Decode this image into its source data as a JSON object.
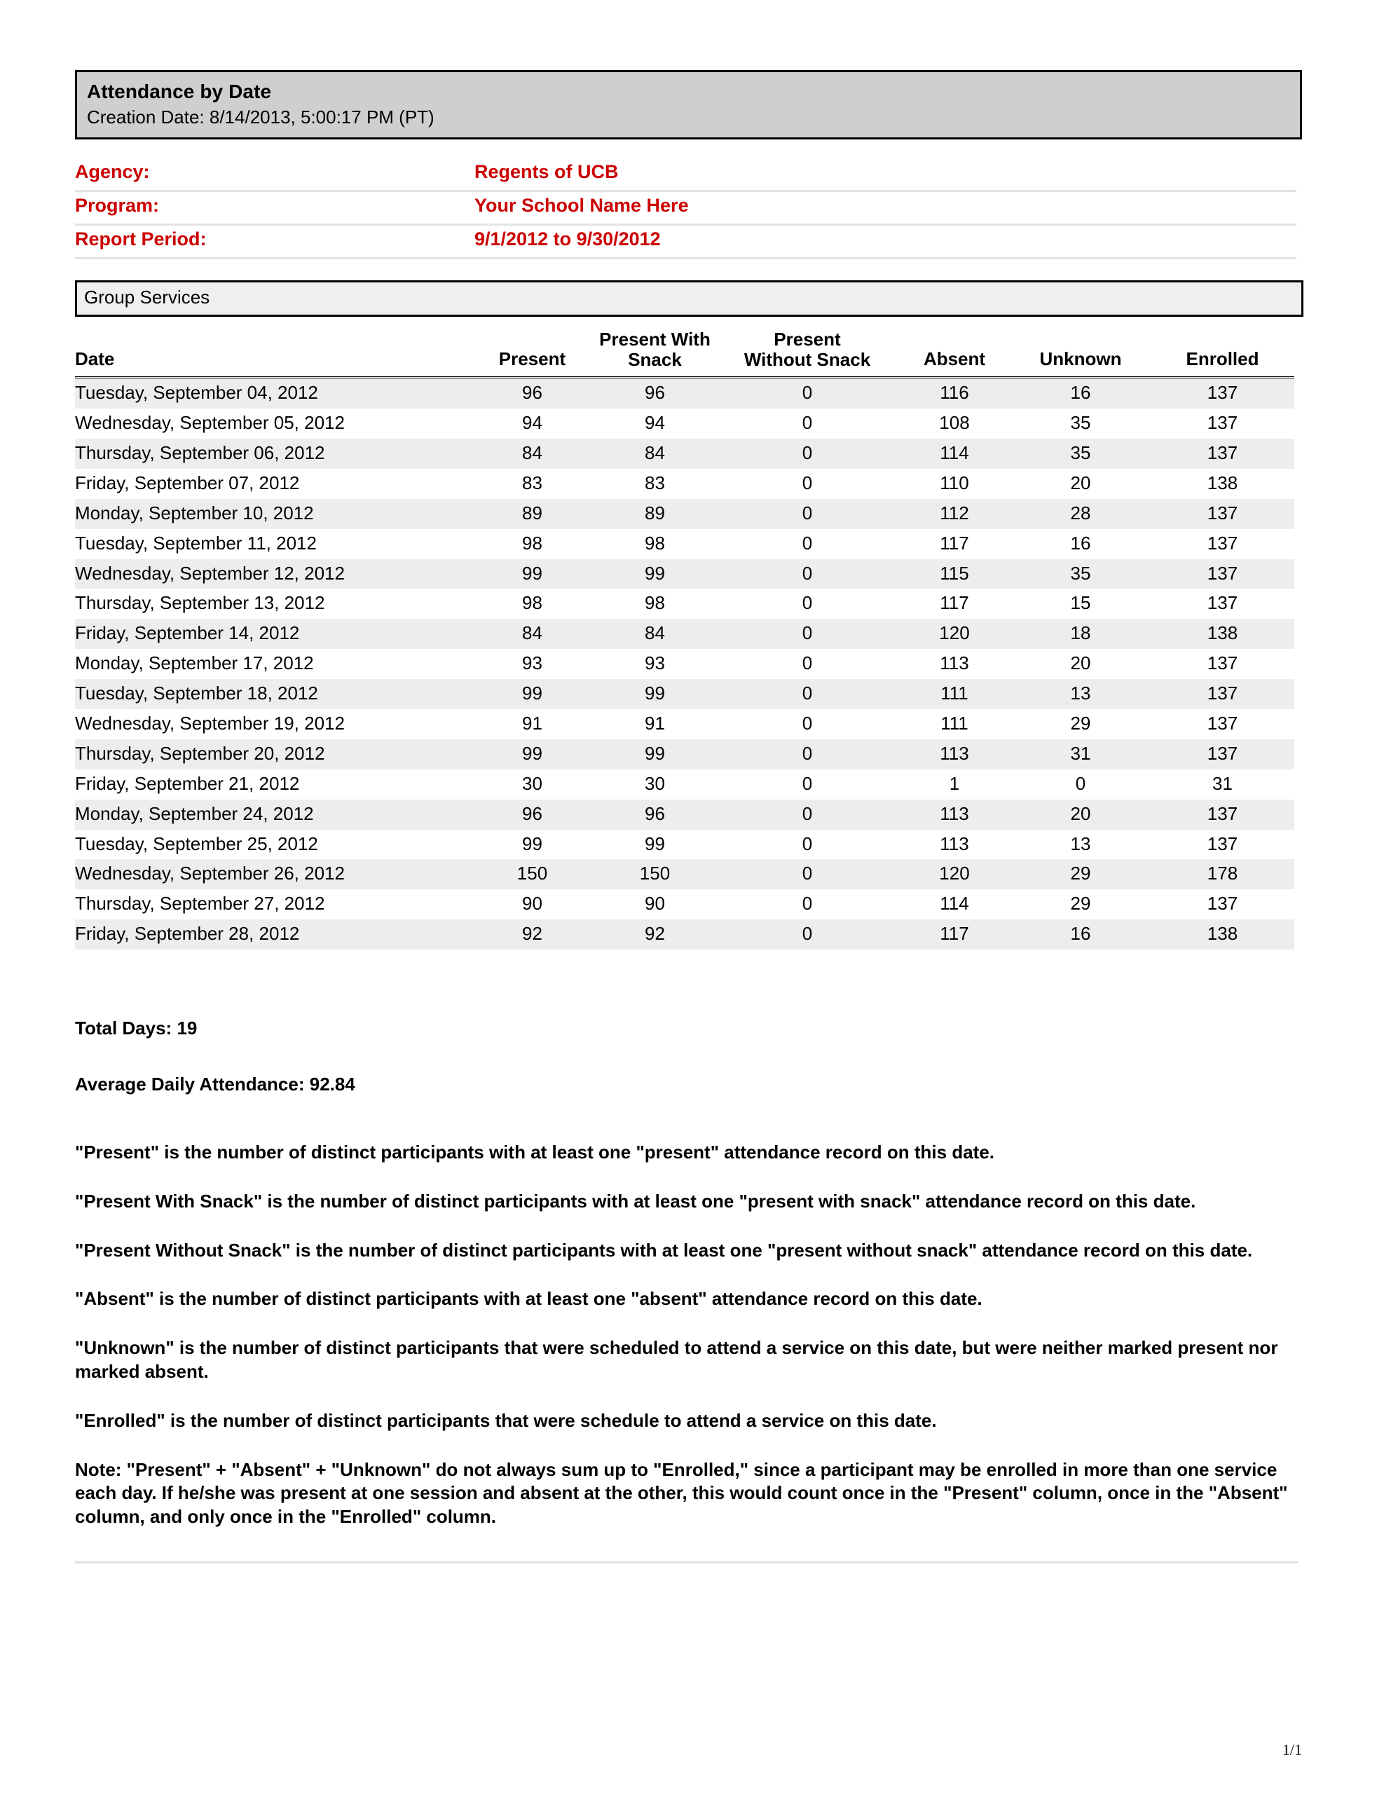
{
  "report": {
    "title": "Attendance by Date",
    "creation_date_label": "Creation Date: 8/14/2013, 5:00:17 PM (PT)",
    "section_title": "Group Services",
    "accent_color": "#cc0000",
    "title_bar_color": "#cfcfcf",
    "section_bar_color": "#efefef",
    "row_stripe_color": "#ededed"
  },
  "meta": {
    "agency_label": "Agency:",
    "agency_value": "Regents of UCB",
    "program_label": "Program:",
    "program_value": "Your School Name Here",
    "period_label": "Report Period:",
    "period_value": "9/1/2012 to 9/30/2012"
  },
  "chart_data": {
    "type": "table",
    "title": "Attendance by Date",
    "columns": [
      "Date",
      "Present",
      "Present With Snack",
      "Present Without Snack",
      "Absent",
      "Unknown",
      "Enrolled"
    ],
    "rows": [
      [
        "Tuesday, September 04, 2012",
        "96",
        "96",
        "0",
        "116",
        "16",
        "137"
      ],
      [
        "Wednesday, September 05, 2012",
        "94",
        "94",
        "0",
        "108",
        "35",
        "137"
      ],
      [
        "Thursday, September 06, 2012",
        "84",
        "84",
        "0",
        "114",
        "35",
        "137"
      ],
      [
        "Friday, September 07, 2012",
        "83",
        "83",
        "0",
        "110",
        "20",
        "138"
      ],
      [
        "Monday, September 10, 2012",
        "89",
        "89",
        "0",
        "112",
        "28",
        "137"
      ],
      [
        "Tuesday, September 11, 2012",
        "98",
        "98",
        "0",
        "117",
        "16",
        "137"
      ],
      [
        "Wednesday, September 12, 2012",
        "99",
        "99",
        "0",
        "115",
        "35",
        "137"
      ],
      [
        "Thursday, September 13, 2012",
        "98",
        "98",
        "0",
        "117",
        "15",
        "137"
      ],
      [
        "Friday, September 14, 2012",
        "84",
        "84",
        "0",
        "120",
        "18",
        "138"
      ],
      [
        "Monday, September 17, 2012",
        "93",
        "93",
        "0",
        "113",
        "20",
        "137"
      ],
      [
        "Tuesday, September 18, 2012",
        "99",
        "99",
        "0",
        "111",
        "13",
        "137"
      ],
      [
        "Wednesday, September 19, 2012",
        "91",
        "91",
        "0",
        "111",
        "29",
        "137"
      ],
      [
        "Thursday, September 20, 2012",
        "99",
        "99",
        "0",
        "113",
        "31",
        "137"
      ],
      [
        "Friday, September 21, 2012",
        "30",
        "30",
        "0",
        "1",
        "0",
        "31"
      ],
      [
        "Monday, September 24, 2012",
        "96",
        "96",
        "0",
        "113",
        "20",
        "137"
      ],
      [
        "Tuesday, September 25, 2012",
        "99",
        "99",
        "0",
        "113",
        "13",
        "137"
      ],
      [
        "Wednesday, September 26, 2012",
        "150",
        "150",
        "0",
        "120",
        "29",
        "178"
      ],
      [
        "Thursday, September 27, 2012",
        "90",
        "90",
        "0",
        "114",
        "29",
        "137"
      ],
      [
        "Friday, September 28, 2012",
        "92",
        "92",
        "0",
        "117",
        "16",
        "138"
      ]
    ]
  },
  "table": {
    "headers": {
      "date": "Date",
      "present": "Present",
      "present_with_snack_l1": "Present With",
      "present_with_snack_l2": "Snack",
      "present_without_snack_l1": "Present",
      "present_without_snack_l2": "Without Snack",
      "absent": "Absent",
      "unknown": "Unknown",
      "enrolled": "Enrolled"
    }
  },
  "totals": {
    "total_days": "Total Days: 19",
    "average_daily_attendance": "Average Daily Attendance: 92.84"
  },
  "notes": [
    "\"Present\" is the number of distinct participants with at least one \"present\" attendance record on this date.",
    "\"Present With Snack\" is the number of distinct participants with at least one \"present with snack\" attendance record on this date.",
    "\"Present Without Snack\" is the number of distinct participants with at least one \"present without snack\" attendance record on this date.",
    "\"Absent\" is the number of distinct participants with at least one \"absent\" attendance record on this date.",
    "\"Unknown\" is the number of distinct participants that were scheduled to attend a service on this date, but were neither marked present nor marked absent.",
    "\"Enrolled\" is the number of distinct participants that were schedule to attend a service on this date.",
    "Note: \"Present\" + \"Absent\" + \"Unknown\" do not always sum up to \"Enrolled,\" since a participant may be enrolled in more than one service each day. If he/she was present at one session and absent at the other, this would count once in the \"Present\" column, once in the \"Absent\" column, and only once in the \"Enrolled\" column."
  ],
  "footer": {
    "page_number": "1/1"
  }
}
